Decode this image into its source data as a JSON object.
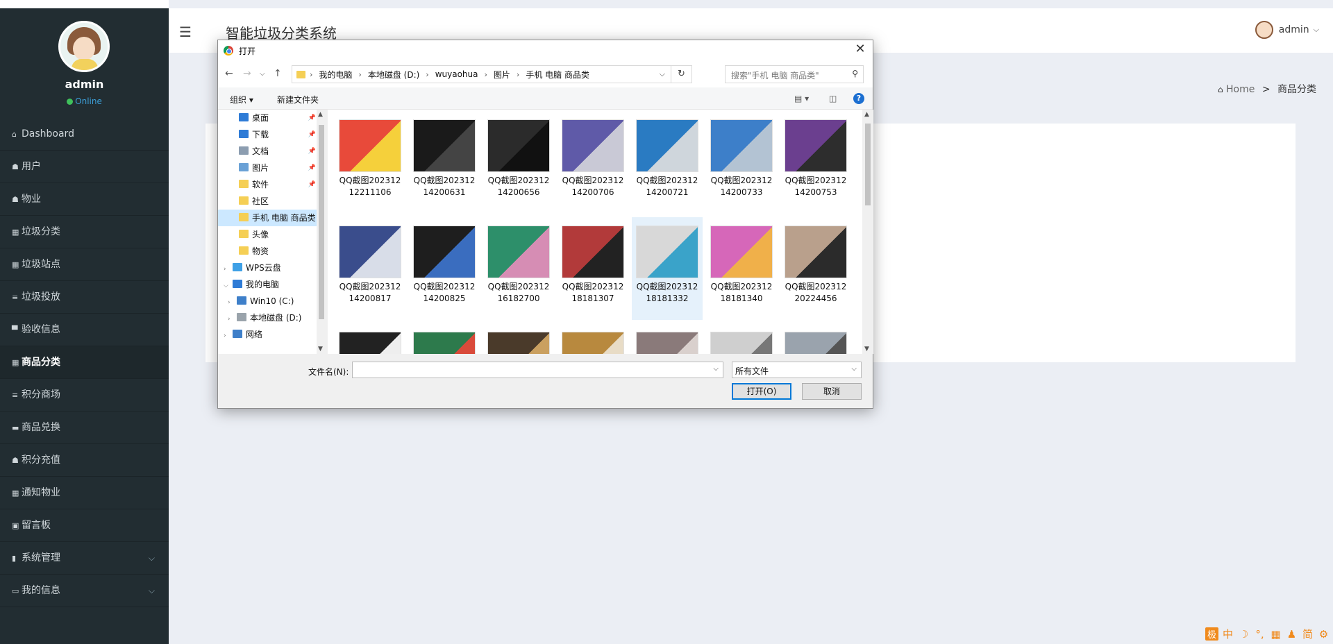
{
  "sidebar": {
    "username": "admin",
    "status": "Online",
    "menu": [
      {
        "label": "Dashboard",
        "icon": "⌂"
      },
      {
        "label": "用户",
        "icon": "☗"
      },
      {
        "label": "物业",
        "icon": "☗"
      },
      {
        "label": "垃圾分类",
        "icon": "▦"
      },
      {
        "label": "垃圾站点",
        "icon": "▦"
      },
      {
        "label": "垃圾投放",
        "icon": "≡"
      },
      {
        "label": "验收信息",
        "icon": "▀"
      },
      {
        "label": "商品分类",
        "icon": "▦"
      },
      {
        "label": "积分商场",
        "icon": "≡"
      },
      {
        "label": "商品兑换",
        "icon": "▬"
      },
      {
        "label": "积分充值",
        "icon": "☗"
      },
      {
        "label": "通知物业",
        "icon": "▦"
      },
      {
        "label": "留言板",
        "icon": "▣"
      },
      {
        "label": "系统管理",
        "icon": "▮"
      },
      {
        "label": "我的信息",
        "icon": "▭"
      }
    ]
  },
  "header": {
    "app_title": "智能垃圾分类系统",
    "user": "admin"
  },
  "breadcrumb": {
    "home": "Home",
    "separator": ">",
    "current": "商品分类"
  },
  "dialog": {
    "title": "打开",
    "address": [
      "我的电脑",
      "本地磁盘 (D:)",
      "wuyaohua",
      "图片",
      "手机 电脑 商品类"
    ],
    "search_placeholder": "搜索\"手机 电脑 商品类\"",
    "toolbar": {
      "organize": "组织 ▾",
      "new_folder": "新建文件夹",
      "help": "?"
    },
    "tree": [
      {
        "label": "桌面",
        "icon_color": "#2e7bd6",
        "pinned": true,
        "indent": 1
      },
      {
        "label": "下载",
        "icon_color": "#2e7bd6",
        "pinned": true,
        "indent": 1
      },
      {
        "label": "文档",
        "icon_color": "#8c9db0",
        "pinned": true,
        "indent": 1
      },
      {
        "label": "图片",
        "icon_color": "#6aa1d6",
        "pinned": true,
        "indent": 1
      },
      {
        "label": "软件",
        "icon_color": "#f5cf55",
        "pinned": true,
        "indent": 1
      },
      {
        "label": "社区",
        "icon_color": "#f5cf55",
        "pinned": false,
        "indent": 1
      },
      {
        "label": "手机 电脑 商品类",
        "icon_color": "#f5cf55",
        "pinned": false,
        "indent": 1,
        "selected": true
      },
      {
        "label": "头像",
        "icon_color": "#f5cf55",
        "pinned": false,
        "indent": 1
      },
      {
        "label": "物资",
        "icon_color": "#f5cf55",
        "pinned": false,
        "indent": 1
      },
      {
        "label": "WPS云盘",
        "icon_color": "#3ea0e6",
        "pinned": false,
        "indent": 0,
        "expander": ">"
      },
      {
        "label": "我的电脑",
        "icon_color": "#2e7bd6",
        "pinned": false,
        "indent": 0,
        "expander": "v"
      },
      {
        "label": "Win10 (C:)",
        "icon_color": "#3e7fc9",
        "pinned": false,
        "indent": 1,
        "expander": ">"
      },
      {
        "label": "本地磁盘 (D:)",
        "icon_color": "#9aa3ab",
        "pinned": false,
        "indent": 1,
        "expander": ">"
      },
      {
        "label": "网络",
        "icon_color": "#3e7fc9",
        "pinned": false,
        "indent": 0,
        "expander": ">"
      }
    ],
    "files": [
      {
        "name": "QQ截图20231212211106",
        "color": "#e84a3a",
        "color2": "#f5d03b"
      },
      {
        "name": "QQ截图20231214200631",
        "color": "#1a1a1a",
        "color2": "#444"
      },
      {
        "name": "QQ截图20231214200656",
        "color": "#2b2b2b",
        "color2": "#111"
      },
      {
        "name": "QQ截图20231214200706",
        "color": "#5f5aa8",
        "color2": "#c9c9d6"
      },
      {
        "name": "QQ截图20231214200721",
        "color": "#2a7bc2",
        "color2": "#cfd6dc"
      },
      {
        "name": "QQ截图20231214200733",
        "color": "#3d7fc9",
        "color2": "#b3c3d3"
      },
      {
        "name": "QQ截图20231214200753",
        "color": "#6b3f8f",
        "color2": "#2d2d2d"
      },
      {
        "name": "QQ截图20231214200817",
        "color": "#3a4d8c",
        "color2": "#d8dde8"
      },
      {
        "name": "QQ截图20231214200825",
        "color": "#1e1e1e",
        "color2": "#3a6dbf"
      },
      {
        "name": "QQ截图20231216182700",
        "color": "#2d8f6a",
        "color2": "#d68db4"
      },
      {
        "name": "QQ截图20231218181307",
        "color": "#b23a3a",
        "color2": "#222"
      },
      {
        "name": "QQ截图20231218181332",
        "color": "#d8d8d8",
        "color2": "#3aa3c9",
        "selected": true
      },
      {
        "name": "QQ截图20231218181340",
        "color": "#d667b9",
        "color2": "#f0b04a"
      },
      {
        "name": "QQ截图20231220224456",
        "color": "#b9a08c",
        "color2": "#2b2b2b"
      },
      {
        "name": "",
        "color": "#222",
        "color2": "#eee"
      },
      {
        "name": "",
        "color": "#2d7a4c",
        "color2": "#d94a3a"
      },
      {
        "name": "",
        "color": "#4a3a2a",
        "color2": "#caa060"
      },
      {
        "name": "",
        "color": "#b8893e",
        "color2": "#e8dcc6"
      },
      {
        "name": "",
        "color": "#8a7a7a",
        "color2": "#d9d0cd"
      },
      {
        "name": "",
        "color": "#cfcfcf",
        "color2": "#777"
      },
      {
        "name": "",
        "color": "#9aa3ad",
        "color2": "#555"
      }
    ],
    "filename_label": "文件名(N):",
    "filename_value": "",
    "filetype": "所有文件",
    "open_button": "打开(O)",
    "cancel_button": "取消"
  },
  "ime": [
    "中",
    "☽",
    "°,",
    "▦",
    "♟",
    "简",
    "⚙"
  ],
  "ime_box": "极"
}
